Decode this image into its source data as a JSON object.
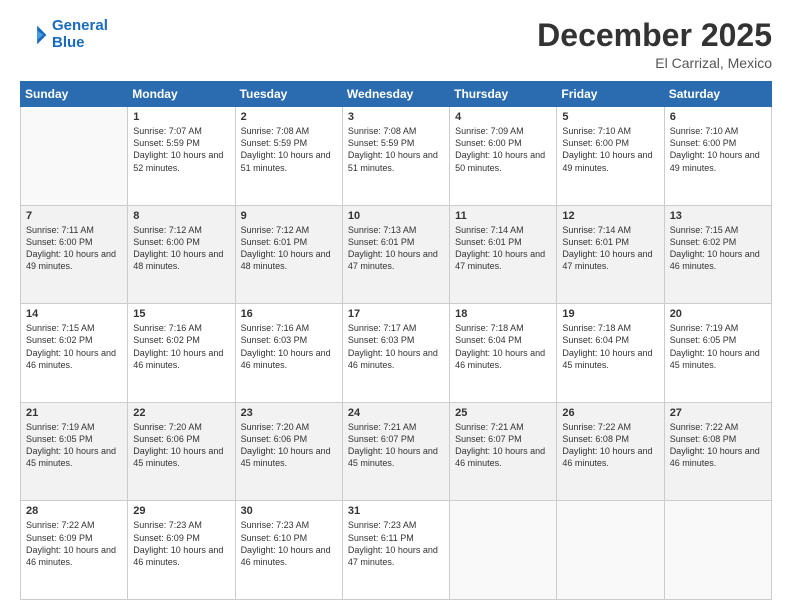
{
  "header": {
    "logo_line1": "General",
    "logo_line2": "Blue",
    "month": "December 2025",
    "location": "El Carrizal, Mexico"
  },
  "weekdays": [
    "Sunday",
    "Monday",
    "Tuesday",
    "Wednesday",
    "Thursday",
    "Friday",
    "Saturday"
  ],
  "rows": [
    [
      {
        "day": "",
        "sunrise": "",
        "sunset": "",
        "daylight": ""
      },
      {
        "day": "1",
        "sunrise": "Sunrise: 7:07 AM",
        "sunset": "Sunset: 5:59 PM",
        "daylight": "Daylight: 10 hours and 52 minutes."
      },
      {
        "day": "2",
        "sunrise": "Sunrise: 7:08 AM",
        "sunset": "Sunset: 5:59 PM",
        "daylight": "Daylight: 10 hours and 51 minutes."
      },
      {
        "day": "3",
        "sunrise": "Sunrise: 7:08 AM",
        "sunset": "Sunset: 5:59 PM",
        "daylight": "Daylight: 10 hours and 51 minutes."
      },
      {
        "day": "4",
        "sunrise": "Sunrise: 7:09 AM",
        "sunset": "Sunset: 6:00 PM",
        "daylight": "Daylight: 10 hours and 50 minutes."
      },
      {
        "day": "5",
        "sunrise": "Sunrise: 7:10 AM",
        "sunset": "Sunset: 6:00 PM",
        "daylight": "Daylight: 10 hours and 49 minutes."
      },
      {
        "day": "6",
        "sunrise": "Sunrise: 7:10 AM",
        "sunset": "Sunset: 6:00 PM",
        "daylight": "Daylight: 10 hours and 49 minutes."
      }
    ],
    [
      {
        "day": "7",
        "sunrise": "Sunrise: 7:11 AM",
        "sunset": "Sunset: 6:00 PM",
        "daylight": "Daylight: 10 hours and 49 minutes."
      },
      {
        "day": "8",
        "sunrise": "Sunrise: 7:12 AM",
        "sunset": "Sunset: 6:00 PM",
        "daylight": "Daylight: 10 hours and 48 minutes."
      },
      {
        "day": "9",
        "sunrise": "Sunrise: 7:12 AM",
        "sunset": "Sunset: 6:01 PM",
        "daylight": "Daylight: 10 hours and 48 minutes."
      },
      {
        "day": "10",
        "sunrise": "Sunrise: 7:13 AM",
        "sunset": "Sunset: 6:01 PM",
        "daylight": "Daylight: 10 hours and 47 minutes."
      },
      {
        "day": "11",
        "sunrise": "Sunrise: 7:14 AM",
        "sunset": "Sunset: 6:01 PM",
        "daylight": "Daylight: 10 hours and 47 minutes."
      },
      {
        "day": "12",
        "sunrise": "Sunrise: 7:14 AM",
        "sunset": "Sunset: 6:01 PM",
        "daylight": "Daylight: 10 hours and 47 minutes."
      },
      {
        "day": "13",
        "sunrise": "Sunrise: 7:15 AM",
        "sunset": "Sunset: 6:02 PM",
        "daylight": "Daylight: 10 hours and 46 minutes."
      }
    ],
    [
      {
        "day": "14",
        "sunrise": "Sunrise: 7:15 AM",
        "sunset": "Sunset: 6:02 PM",
        "daylight": "Daylight: 10 hours and 46 minutes."
      },
      {
        "day": "15",
        "sunrise": "Sunrise: 7:16 AM",
        "sunset": "Sunset: 6:02 PM",
        "daylight": "Daylight: 10 hours and 46 minutes."
      },
      {
        "day": "16",
        "sunrise": "Sunrise: 7:16 AM",
        "sunset": "Sunset: 6:03 PM",
        "daylight": "Daylight: 10 hours and 46 minutes."
      },
      {
        "day": "17",
        "sunrise": "Sunrise: 7:17 AM",
        "sunset": "Sunset: 6:03 PM",
        "daylight": "Daylight: 10 hours and 46 minutes."
      },
      {
        "day": "18",
        "sunrise": "Sunrise: 7:18 AM",
        "sunset": "Sunset: 6:04 PM",
        "daylight": "Daylight: 10 hours and 46 minutes."
      },
      {
        "day": "19",
        "sunrise": "Sunrise: 7:18 AM",
        "sunset": "Sunset: 6:04 PM",
        "daylight": "Daylight: 10 hours and 45 minutes."
      },
      {
        "day": "20",
        "sunrise": "Sunrise: 7:19 AM",
        "sunset": "Sunset: 6:05 PM",
        "daylight": "Daylight: 10 hours and 45 minutes."
      }
    ],
    [
      {
        "day": "21",
        "sunrise": "Sunrise: 7:19 AM",
        "sunset": "Sunset: 6:05 PM",
        "daylight": "Daylight: 10 hours and 45 minutes."
      },
      {
        "day": "22",
        "sunrise": "Sunrise: 7:20 AM",
        "sunset": "Sunset: 6:06 PM",
        "daylight": "Daylight: 10 hours and 45 minutes."
      },
      {
        "day": "23",
        "sunrise": "Sunrise: 7:20 AM",
        "sunset": "Sunset: 6:06 PM",
        "daylight": "Daylight: 10 hours and 45 minutes."
      },
      {
        "day": "24",
        "sunrise": "Sunrise: 7:21 AM",
        "sunset": "Sunset: 6:07 PM",
        "daylight": "Daylight: 10 hours and 45 minutes."
      },
      {
        "day": "25",
        "sunrise": "Sunrise: 7:21 AM",
        "sunset": "Sunset: 6:07 PM",
        "daylight": "Daylight: 10 hours and 46 minutes."
      },
      {
        "day": "26",
        "sunrise": "Sunrise: 7:22 AM",
        "sunset": "Sunset: 6:08 PM",
        "daylight": "Daylight: 10 hours and 46 minutes."
      },
      {
        "day": "27",
        "sunrise": "Sunrise: 7:22 AM",
        "sunset": "Sunset: 6:08 PM",
        "daylight": "Daylight: 10 hours and 46 minutes."
      }
    ],
    [
      {
        "day": "28",
        "sunrise": "Sunrise: 7:22 AM",
        "sunset": "Sunset: 6:09 PM",
        "daylight": "Daylight: 10 hours and 46 minutes."
      },
      {
        "day": "29",
        "sunrise": "Sunrise: 7:23 AM",
        "sunset": "Sunset: 6:09 PM",
        "daylight": "Daylight: 10 hours and 46 minutes."
      },
      {
        "day": "30",
        "sunrise": "Sunrise: 7:23 AM",
        "sunset": "Sunset: 6:10 PM",
        "daylight": "Daylight: 10 hours and 46 minutes."
      },
      {
        "day": "31",
        "sunrise": "Sunrise: 7:23 AM",
        "sunset": "Sunset: 6:11 PM",
        "daylight": "Daylight: 10 hours and 47 minutes."
      },
      {
        "day": "",
        "sunrise": "",
        "sunset": "",
        "daylight": ""
      },
      {
        "day": "",
        "sunrise": "",
        "sunset": "",
        "daylight": ""
      },
      {
        "day": "",
        "sunrise": "",
        "sunset": "",
        "daylight": ""
      }
    ]
  ]
}
